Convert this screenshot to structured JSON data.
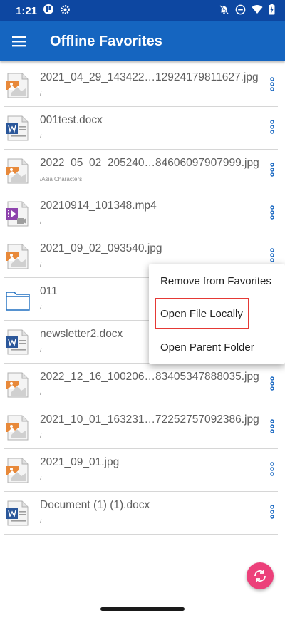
{
  "status_bar": {
    "time": "1:21"
  },
  "app_bar": {
    "title": "Offline Favorites"
  },
  "items": [
    {
      "name": "2021_04_29_143422…12924179811627.jpg",
      "path": "/",
      "icon": "image-file-icon"
    },
    {
      "name": "001test.docx",
      "path": "/",
      "icon": "word-doc-icon"
    },
    {
      "name": "2022_05_02_205240…84606097907999.jpg",
      "path": "/Asia Characters",
      "icon": "image-file-icon"
    },
    {
      "name": "20210914_101348.mp4",
      "path": "/",
      "icon": "video-file-icon"
    },
    {
      "name": "2021_09_02_093540.jpg",
      "path": "/",
      "icon": "image-file-icon"
    },
    {
      "name": "011",
      "path": "/",
      "icon": "folder-icon"
    },
    {
      "name": "newsletter2.docx",
      "path": "/",
      "icon": "word-doc-icon"
    },
    {
      "name": "2022_12_16_100206…83405347888035.jpg",
      "path": "/",
      "icon": "image-file-icon"
    },
    {
      "name": "2021_10_01_163231…72252757092386.jpg",
      "path": "/",
      "icon": "image-file-icon"
    },
    {
      "name": "2021_09_01.jpg",
      "path": "/",
      "icon": "image-file-icon"
    },
    {
      "name": "Document (1) (1).docx",
      "path": "/",
      "icon": "word-doc-icon"
    }
  ],
  "context_menu": {
    "remove": "Remove from Favorites",
    "open_locally": "Open File Locally",
    "open_parent": "Open Parent Folder"
  },
  "colors": {
    "status_bar": "#0d47a1",
    "app_bar": "#1565c0",
    "fab": "#ec407a",
    "highlight": "#e53935",
    "more_dots": "#1565c0"
  }
}
